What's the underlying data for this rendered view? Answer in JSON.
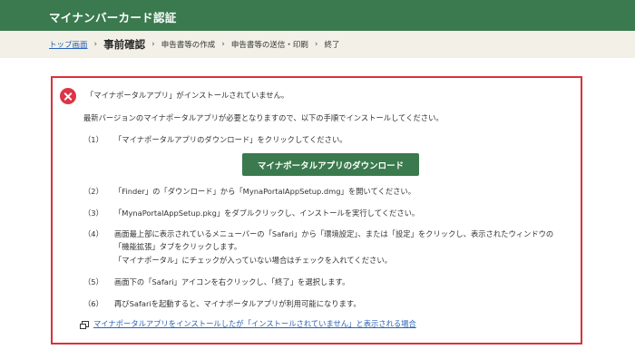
{
  "header": {
    "title": "マイナンバーカード認証"
  },
  "breadcrumb": {
    "top_link": "トップ画面",
    "current": "事前確認",
    "step3": "申告書等の作成",
    "step4": "申告書等の送信・印刷",
    "step5": "終了",
    "separator": "›"
  },
  "error": {
    "title": "「マイナポータルアプリ」がインストールされていません。",
    "intro": "最新バージョンのマイナポータルアプリが必要となりますので、以下の手順でインストールしてください。"
  },
  "steps": [
    {
      "num": "（1）",
      "text": "「マイナポータルアプリのダウンロード」をクリックしてください。"
    },
    {
      "num": "（2）",
      "text": "「Finder」の「ダウンロード」から「MynaPortalAppSetup.dmg」を開いてください。"
    },
    {
      "num": "（3）",
      "text": "「MynaPortalAppSetup.pkg」をダブルクリックし、インストールを実行してください。"
    },
    {
      "num": "（4）",
      "text": "画面最上部に表示されているメニューバーの「Safari」から「環境設定」、または「設定」をクリックし、表示されたウィンドウの",
      "text2": "「機能拡張」タブをクリックします。",
      "text3": "「マイナポータル」にチェックが入っていない場合はチェックを入れてください。"
    },
    {
      "num": "（5）",
      "text": "画面下の「Safari」アイコンを右クリックし、「終了」を選択します。"
    },
    {
      "num": "（6）",
      "text": "再びSafariを起動すると、マイナポータルアプリが利用可能になります。"
    }
  ],
  "download_button": "マイナポータルアプリのダウンロード",
  "help_link": "マイナポータルアプリをインストールしたが「インストールされていません」と表示される場合",
  "colors": {
    "header": "#3a7a4e",
    "error_border": "#d8333a",
    "link": "#2a62b8"
  },
  "icons": {
    "error": "error-x-circle-icon",
    "help": "external-window-icon"
  }
}
